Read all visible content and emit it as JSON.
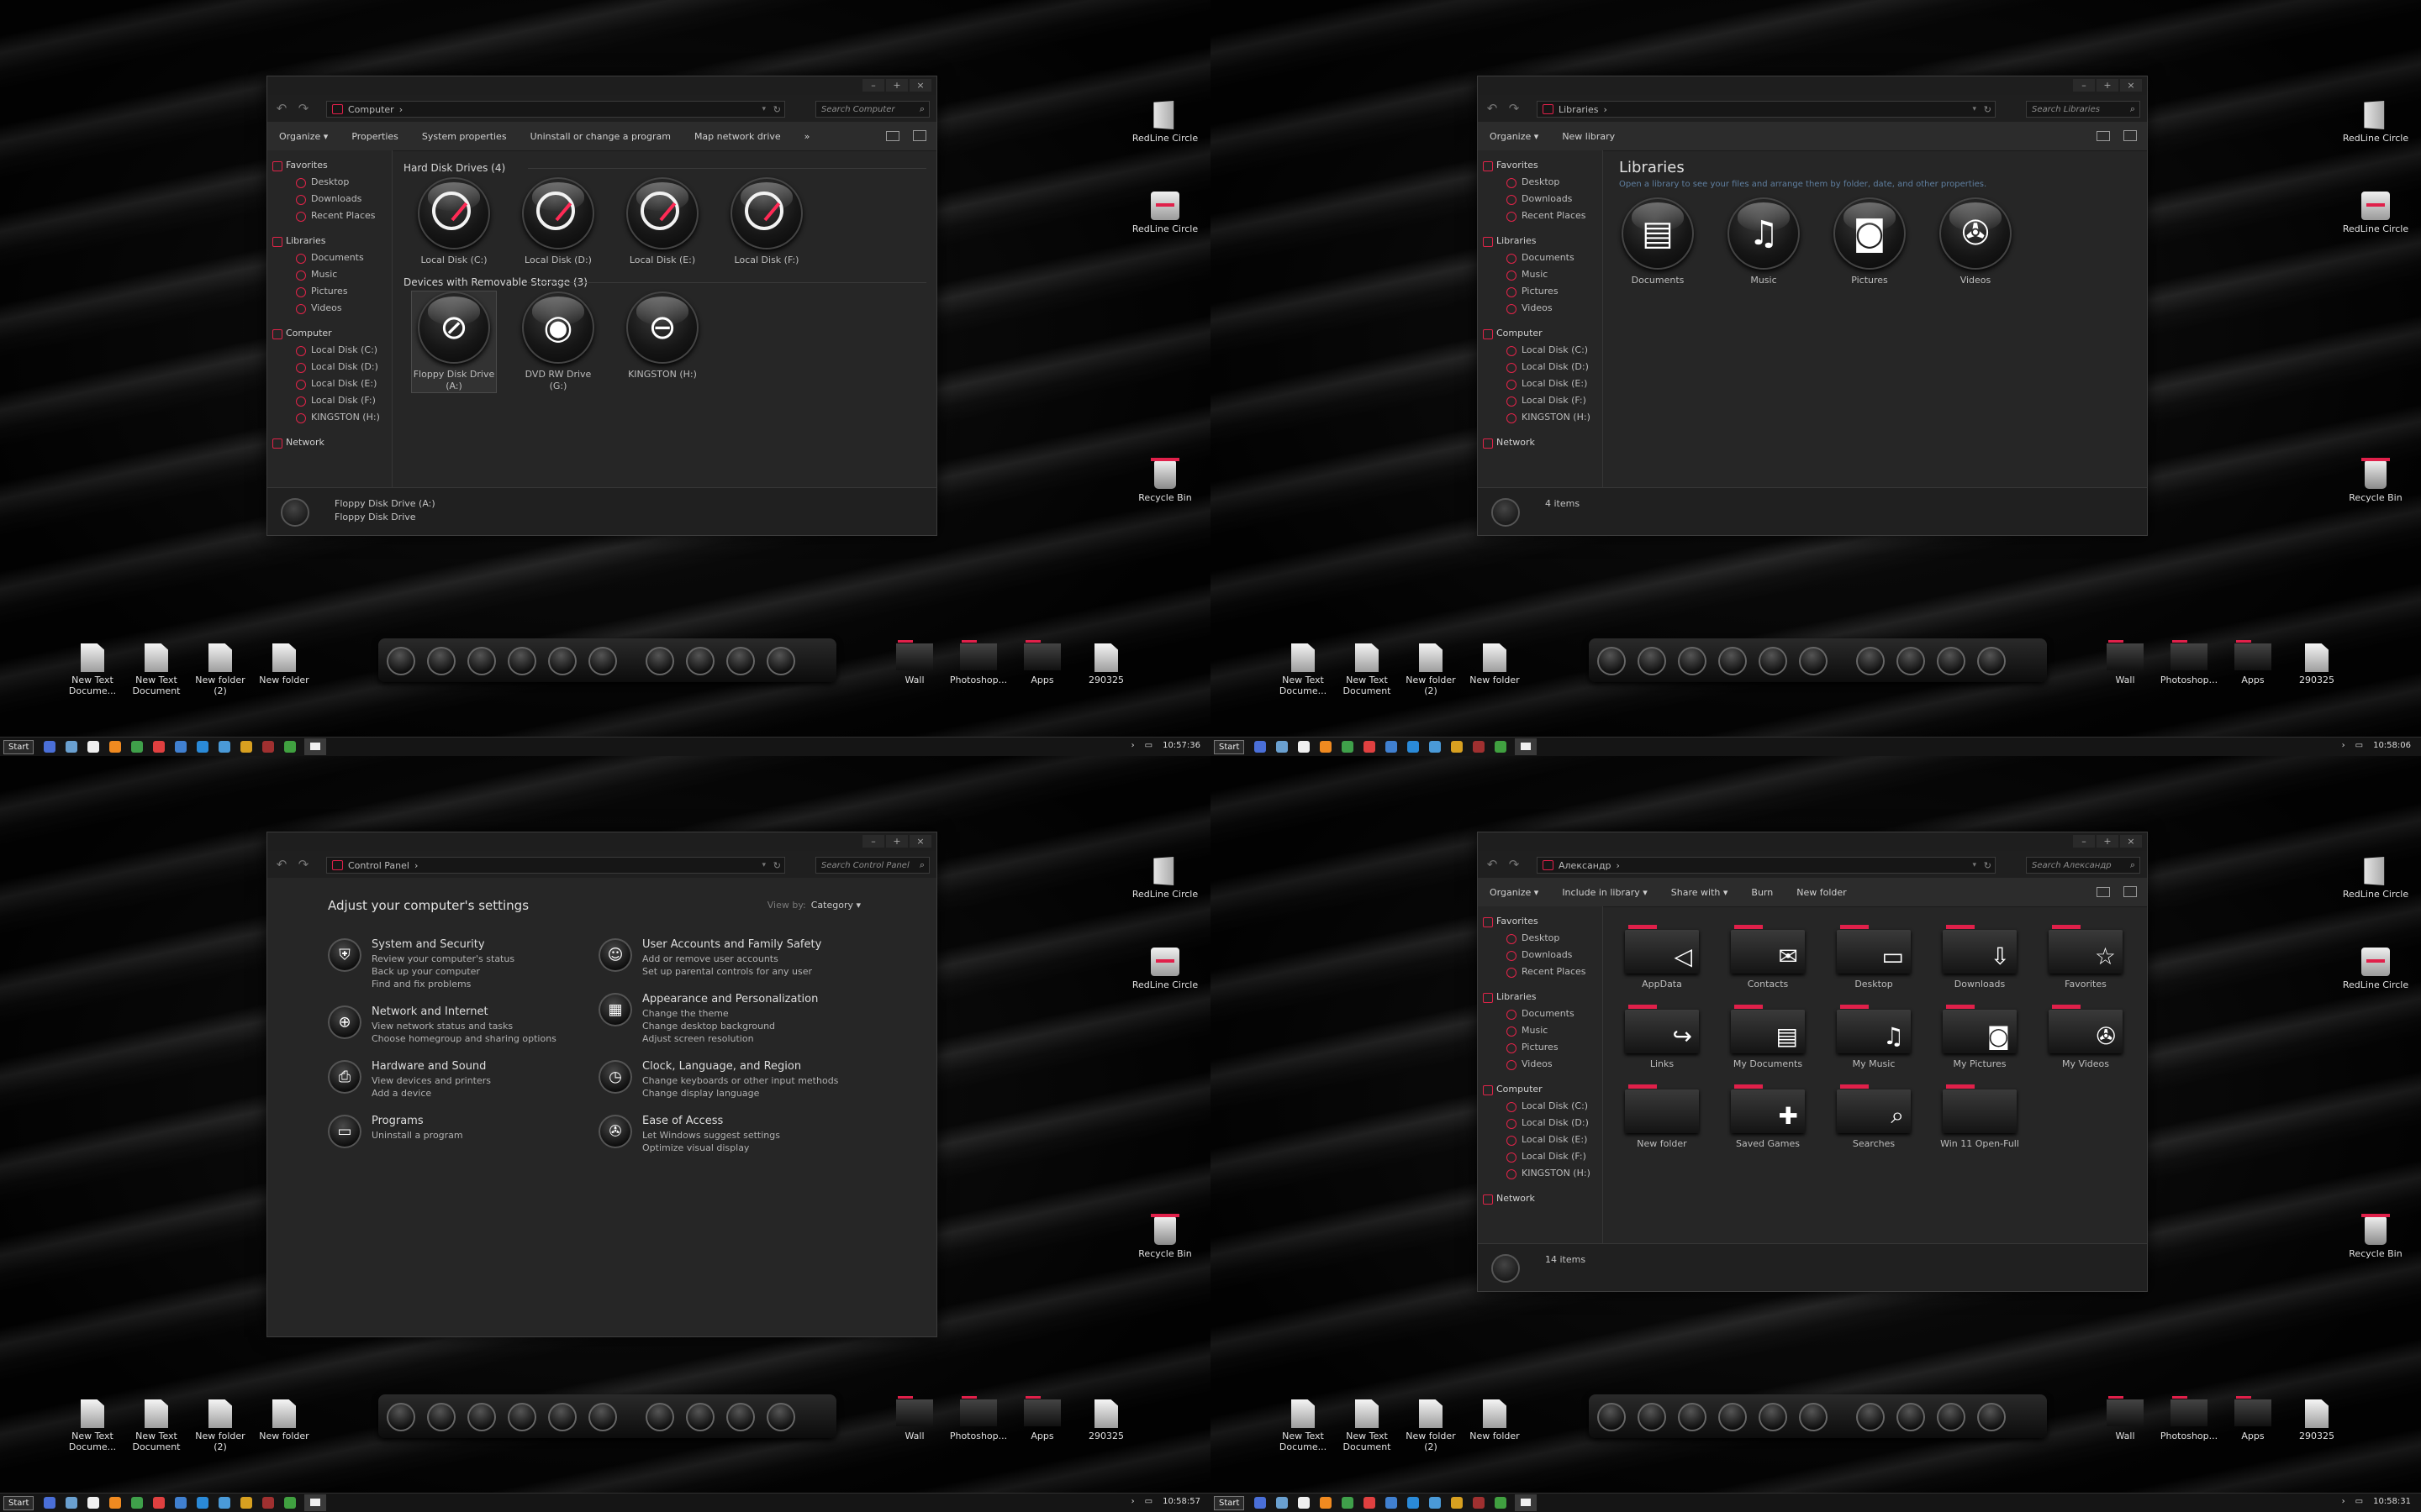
{
  "desktop_icons": {
    "redline1": "RedLine Circle",
    "redline2": "RedLine Circle",
    "recycle": "Recycle Bin"
  },
  "dock": {
    "left_files": [
      {
        "label": "New Text Docume...",
        "kind": "doc"
      },
      {
        "label": "New Text Document",
        "kind": "doc"
      },
      {
        "label": "New folder (2)",
        "kind": "book"
      },
      {
        "label": "New folder",
        "kind": "book"
      }
    ],
    "orbs": [
      "computer-icon",
      "globe-icon",
      "user-icon",
      "gamepad-icon",
      "drive-icon",
      "clock-icon",
      "gauge-icon",
      "gauge2-icon",
      "folder-icon",
      "download-icon"
    ],
    "right_files": [
      {
        "label": "Wall",
        "kind": "folder"
      },
      {
        "label": "Photoshop...",
        "kind": "folder"
      },
      {
        "label": "Apps",
        "kind": "folder"
      },
      {
        "label": "290325",
        "kind": "book"
      }
    ]
  },
  "taskbar": {
    "start": "Start",
    "times": [
      "10:57:36",
      "10:58:06",
      "10:58:57",
      "10:58:31"
    ]
  },
  "nav": {
    "favorites": "Favorites",
    "favorites_items": [
      "Desktop",
      "Downloads",
      "Recent Places"
    ],
    "libraries": "Libraries",
    "libraries_items": [
      "Documents",
      "Music",
      "Pictures",
      "Videos"
    ],
    "computer": "Computer",
    "computer_items": [
      "Local Disk (C:)",
      "Local Disk (D:)",
      "Local Disk (E:)",
      "Local Disk (F:)",
      "KINGSTON (H:)"
    ],
    "network": "Network"
  },
  "win_computer": {
    "address": "Computer",
    "search": "Search Computer",
    "commands": [
      "Organize ▾",
      "Properties",
      "System properties",
      "Uninstall or change a program",
      "Map network drive",
      "»"
    ],
    "group1": "Hard Disk Drives (4)",
    "drives": [
      "Local Disk (C:)",
      "Local Disk (D:)",
      "Local Disk (E:)",
      "Local Disk (F:)"
    ],
    "group2": "Devices with Removable Storage (3)",
    "removable": [
      "Floppy Disk Drive (A:)",
      "DVD RW Drive (G:)",
      "KINGSTON (H:)"
    ],
    "details_line1": "Floppy Disk Drive (A:)",
    "details_line2": "Floppy Disk Drive"
  },
  "win_libraries": {
    "address": "Libraries",
    "search": "Search Libraries",
    "commands": [
      "Organize ▾",
      "New library"
    ],
    "title": "Libraries",
    "subtitle": "Open a library to see your files and arrange them by folder, date, and other properties.",
    "items": [
      {
        "label": "Documents",
        "glyph": "▤"
      },
      {
        "label": "Music",
        "glyph": "♫"
      },
      {
        "label": "Pictures",
        "glyph": "◙"
      },
      {
        "label": "Videos",
        "glyph": "✇"
      }
    ],
    "count": "4 items"
  },
  "win_control": {
    "address": "Control Panel",
    "search": "Search Control Panel",
    "title": "Adjust your computer's settings",
    "viewby_label": "View by:",
    "viewby_value": "Category ▾",
    "left": [
      {
        "head": "System and Security",
        "subs": [
          "Review your computer's status",
          "Back up your computer",
          "Find and fix problems"
        ],
        "glyph": "⛨"
      },
      {
        "head": "Network and Internet",
        "subs": [
          "View network status and tasks",
          "Choose homegroup and sharing options"
        ],
        "glyph": "⊕"
      },
      {
        "head": "Hardware and Sound",
        "subs": [
          "View devices and printers",
          "Add a device"
        ],
        "glyph": "⎙"
      },
      {
        "head": "Programs",
        "subs": [
          "Uninstall a program"
        ],
        "glyph": "▭"
      }
    ],
    "right": [
      {
        "head": "User Accounts and Family Safety",
        "subs": [
          "Add or remove user accounts",
          "Set up parental controls for any user"
        ],
        "glyph": "☺"
      },
      {
        "head": "Appearance and Personalization",
        "subs": [
          "Change the theme",
          "Change desktop background",
          "Adjust screen resolution"
        ],
        "glyph": "▦"
      },
      {
        "head": "Clock, Language, and Region",
        "subs": [
          "Change keyboards or other input methods",
          "Change display language"
        ],
        "glyph": "◷"
      },
      {
        "head": "Ease of Access",
        "subs": [
          "Let Windows suggest settings",
          "Optimize visual display"
        ],
        "glyph": "✇"
      }
    ]
  },
  "win_user": {
    "address": "Александр",
    "search": "Search Александр",
    "commands": [
      "Organize ▾",
      "Include in library ▾",
      "Share with ▾",
      "Burn",
      "New folder"
    ],
    "items": [
      {
        "label": "AppData",
        "glyph": "◁"
      },
      {
        "label": "Contacts",
        "glyph": "✉"
      },
      {
        "label": "Desktop",
        "glyph": "▭"
      },
      {
        "label": "Downloads",
        "glyph": "⇩"
      },
      {
        "label": "Favorites",
        "glyph": "☆"
      },
      {
        "label": "Links",
        "glyph": "↪"
      },
      {
        "label": "My Documents",
        "glyph": "▤"
      },
      {
        "label": "My Music",
        "glyph": "♫"
      },
      {
        "label": "My Pictures",
        "glyph": "◙"
      },
      {
        "label": "My Videos",
        "glyph": "✇"
      },
      {
        "label": "New folder",
        "glyph": ""
      },
      {
        "label": "Saved Games",
        "glyph": "✚"
      },
      {
        "label": "Searches",
        "glyph": "⌕"
      },
      {
        "label": "Win 11 Open-Full",
        "glyph": ""
      }
    ],
    "count": "14 items"
  }
}
